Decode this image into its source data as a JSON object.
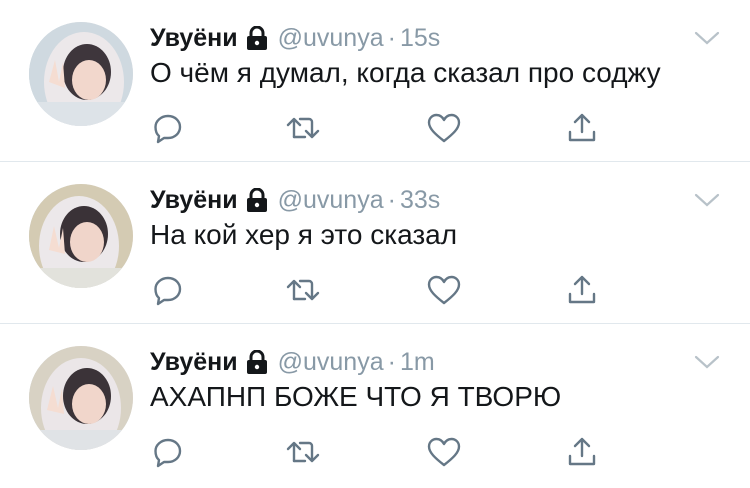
{
  "tweets": [
    {
      "name": "Увуёни",
      "handle": "@uvunya",
      "separator": "·",
      "time": "15s",
      "text": "О чём я думал, когда сказал про соджу"
    },
    {
      "name": "Увуёни",
      "handle": "@uvunya",
      "separator": "·",
      "time": "33s",
      "text": "На кой хер я это сказал"
    },
    {
      "name": "Увуёни",
      "handle": "@uvunya",
      "separator": "·",
      "time": "1m",
      "text": "АХАПНП БОЖЕ ЧТО Я ТВОРЮ"
    }
  ],
  "icons": {
    "protected": "lock-icon",
    "menu": "chevron-down-icon",
    "reply": "reply-icon",
    "retweet": "retweet-icon",
    "like": "heart-icon",
    "share": "share-icon"
  },
  "colors": {
    "text": "#14171a",
    "secondary": "#8899a6",
    "divider": "#e1e8ed",
    "icon": "#657786"
  }
}
